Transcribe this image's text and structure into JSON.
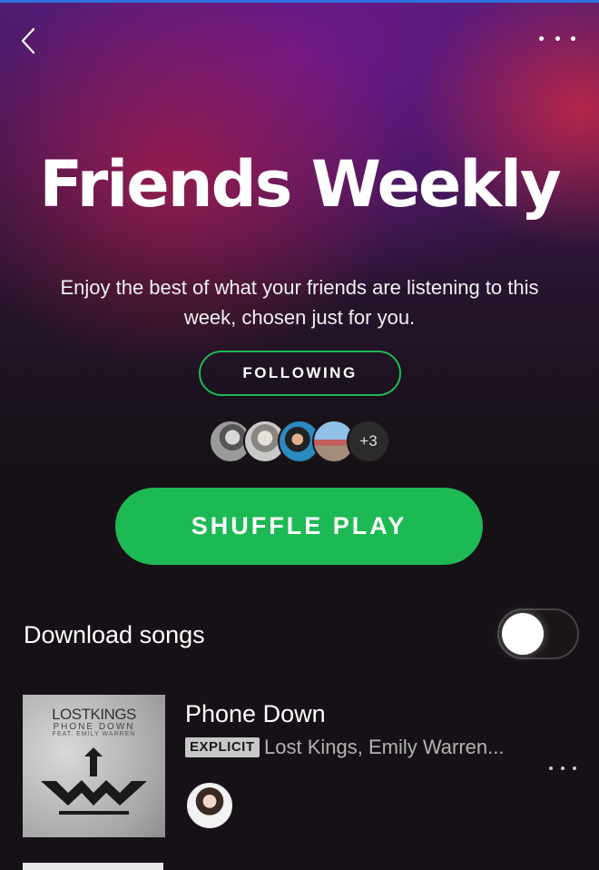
{
  "header": {
    "back_icon": "chevron-left-icon",
    "more_icon": "more-horizontal-icon"
  },
  "playlist": {
    "title": "Friends Weekly",
    "description": "Enjoy the best of what your friends are listening to this week, chosen just for you.",
    "follow_label": "FOLLOWING",
    "followers_more": "+3",
    "shuffle_label": "SHUFFLE PLAY"
  },
  "download": {
    "label": "Download songs",
    "enabled": false
  },
  "tracks": [
    {
      "title": "Phone Down",
      "explicit_label": "EXPLICIT",
      "artists": "Lost Kings, Emily Warren...",
      "cover": {
        "title": "LOSTKINGS",
        "subtitle": "PHONE DOWN",
        "feat": "FEAT. EMILY WARREN"
      }
    }
  ],
  "colors": {
    "accent": "#1db954",
    "background": "#161116",
    "gradient_top": "#4a1d6e"
  }
}
